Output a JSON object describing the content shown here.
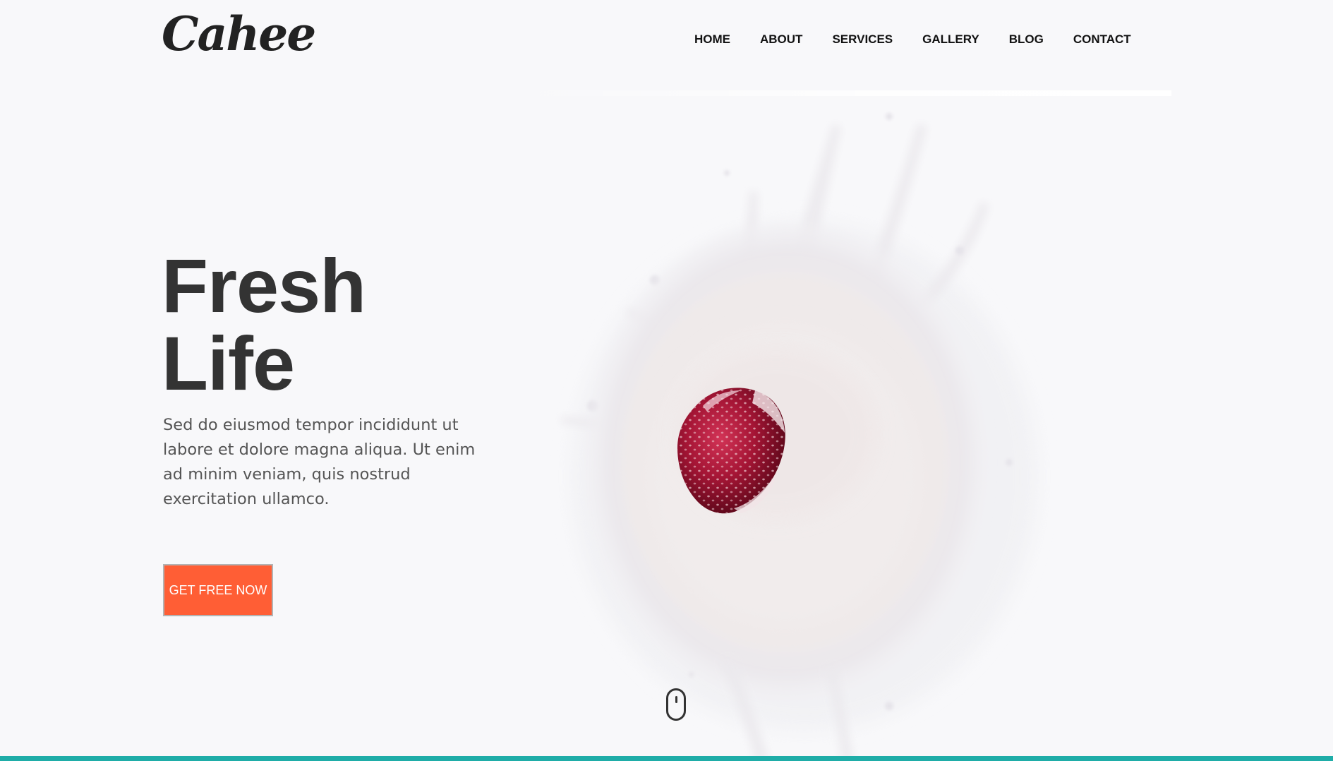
{
  "brand": {
    "logo_text": "Cahee"
  },
  "nav": {
    "items": [
      {
        "label": "HOME"
      },
      {
        "label": "ABOUT"
      },
      {
        "label": "SERVICES"
      },
      {
        "label": "GALLERY"
      },
      {
        "label": "BLOG"
      },
      {
        "label": "CONTACT"
      }
    ]
  },
  "hero": {
    "title_line_1": "Fresh",
    "title_line_2": "Life",
    "description": "Sed do eiusmod tempor incididunt ut labore et dolore magna aliqua. Ut enim ad minim veniam, quis nostrud exercitation ullamco.",
    "cta_label": "GET FREE NOW",
    "image": "strawberry-splashing-into-milk"
  },
  "icons": {
    "scroll": "mouse-scroll-icon"
  },
  "colors": {
    "background": "#f8f8fa",
    "heading": "#333333",
    "body_text": "#555555",
    "cta_background": "#ff5e35",
    "cta_text": "#ffffff",
    "accent_bar": "#1fada8"
  }
}
